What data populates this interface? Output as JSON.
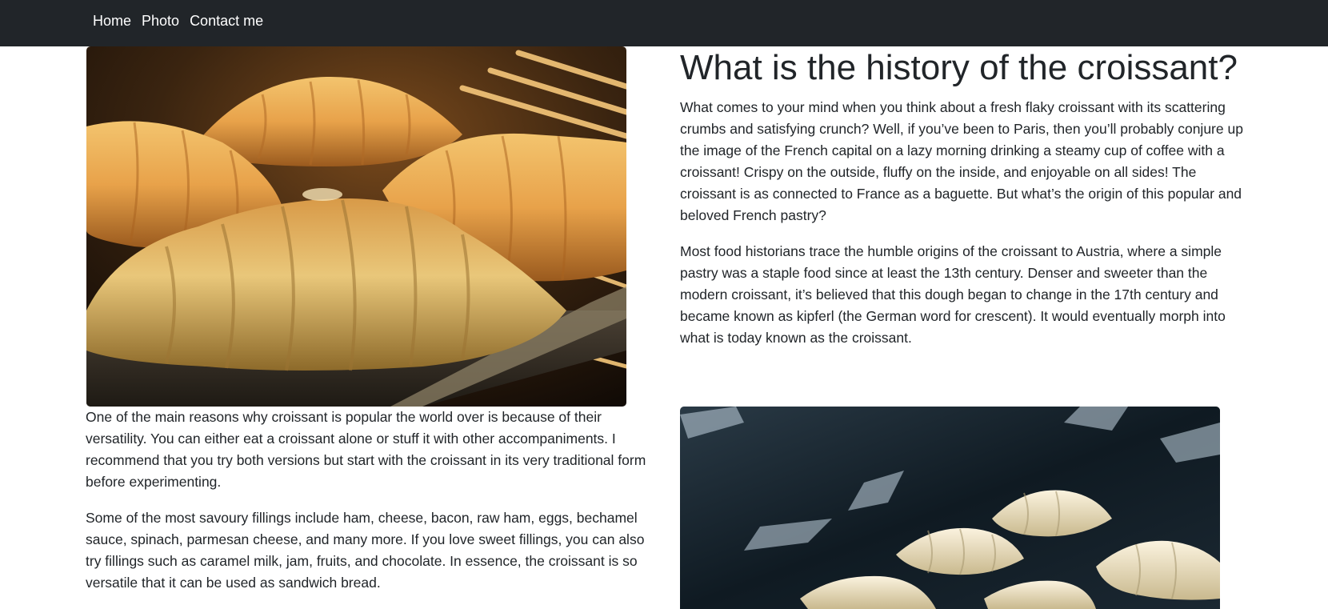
{
  "nav": {
    "home": "Home",
    "photo": "Photo",
    "contact": "Contact me"
  },
  "article": {
    "heading": "What is the history of the croissant?",
    "para1": "What comes to your mind when you think about a fresh flaky croissant with its scattering crumbs and satisfying crunch? Well, if you’ve been to Paris, then you’ll probably conjure up the image of the French capital on a lazy morning drinking a steamy cup of coffee with a croissant! Crispy on the outside, fluffy on the inside, and enjoyable on all sides! The croissant is as connected to France as a baguette. But what’s the origin of this popular and beloved French pastry?",
    "para2": "Most food historians trace the humble origins of the croissant to Austria, where a simple pastry was a staple food since at least the 13th century. Denser and sweeter than the modern croissant, it’s believed that this dough began to change in the 17th century and became known as kipferl (the German word for crescent). It would eventually morph into what is today known as the croissant.",
    "para3": "One of the main reasons why croissant is popular the world over is because of their versatility. You can either eat a croissant alone or stuff it with other accompaniments. I recommend that you try both versions but start with the croissant in its very traditional form before experimenting.",
    "para4": "Some of the most savoury fillings include ham, cheese, bacon, raw ham, eggs, bechamel sauce, spinach, parmesan cheese, and many more. If you love sweet fillings, you can also try fillings such as caramel milk, jam, fruits, and chocolate. In essence, the croissant is so versatile that it can be used as sandwich bread."
  },
  "colors": {
    "navbar": "#212529",
    "text": "#212529",
    "nav_text": "#ffffff"
  }
}
